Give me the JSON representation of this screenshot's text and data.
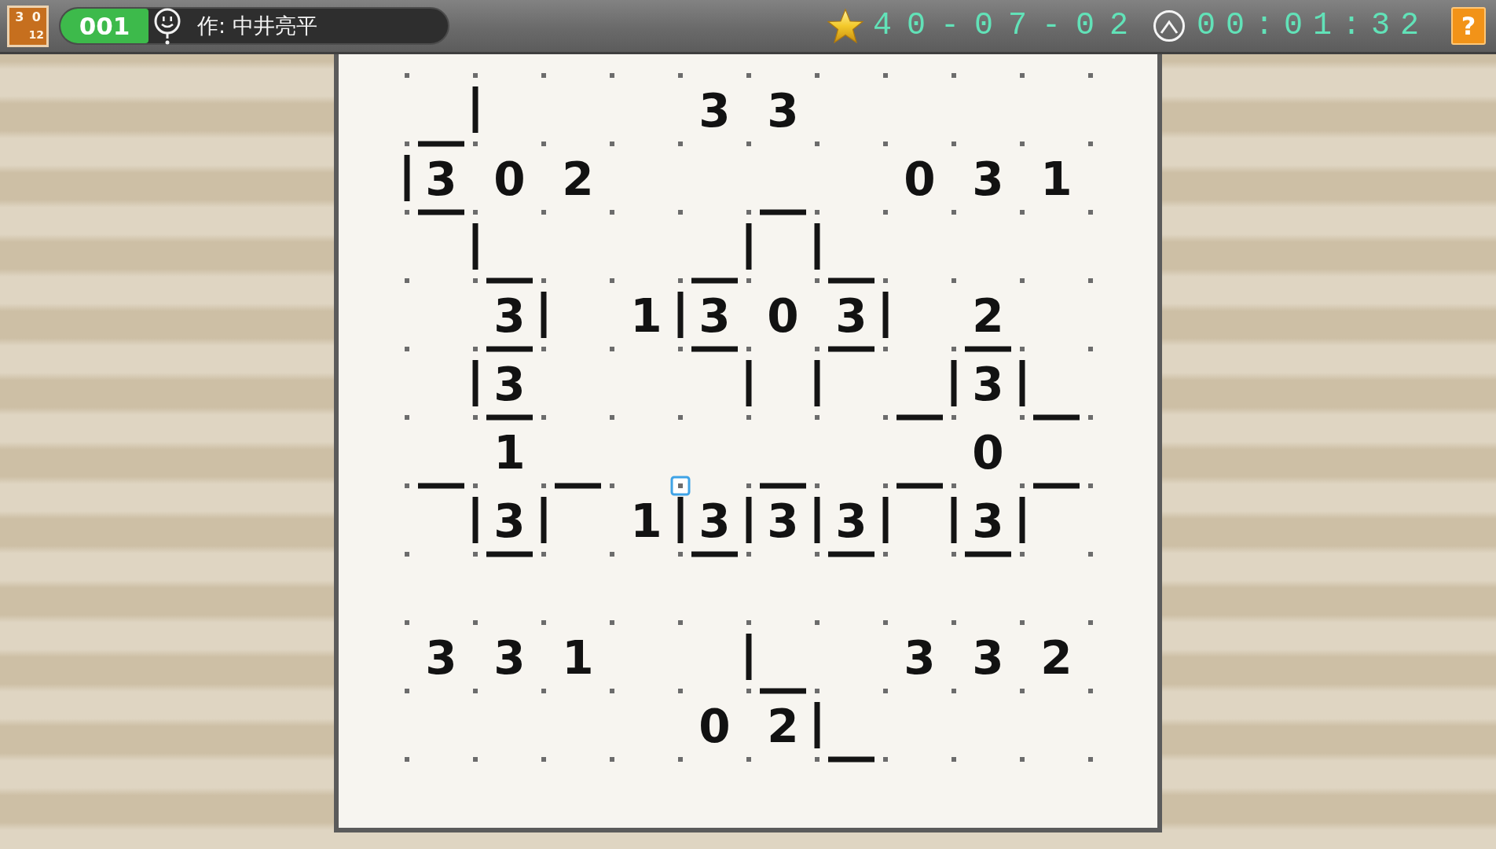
{
  "header": {
    "app_logo": {
      "top_digits": [
        "3",
        "0"
      ],
      "bottom_digits": "12"
    },
    "puzzle_number": "001",
    "author": "作: 中井亮平",
    "date_code": "40-07-02",
    "timer": "00:01:32",
    "help_button": "?"
  },
  "grid": {
    "rows": [
      [
        {
          "kind": "dot"
        },
        {
          "kind": "gap"
        },
        {
          "kind": "dot"
        },
        {
          "kind": "gap"
        },
        {
          "kind": "dot"
        },
        {
          "kind": "gap"
        },
        {
          "kind": "dot"
        },
        {
          "kind": "gap"
        },
        {
          "kind": "dot"
        },
        {
          "kind": "gap"
        },
        {
          "kind": "dot"
        },
        {
          "kind": "gap"
        },
        {
          "kind": "dot"
        },
        {
          "kind": "gap"
        },
        {
          "kind": "dot"
        },
        {
          "kind": "gap"
        },
        {
          "kind": "dot"
        },
        {
          "kind": "gap"
        },
        {
          "kind": "dot"
        },
        {
          "kind": "gap"
        },
        {
          "kind": "dot"
        }
      ],
      [
        {
          "kind": "gap"
        },
        {
          "kind": "blank"
        },
        {
          "kind": "line"
        },
        {
          "kind": "blank"
        },
        {
          "kind": "gap"
        },
        {
          "kind": "blank"
        },
        {
          "kind": "gap"
        },
        {
          "kind": "blank"
        },
        {
          "kind": "gap"
        },
        {
          "kind": "clue",
          "text": "3"
        },
        {
          "kind": "gap"
        },
        {
          "kind": "clue",
          "text": "3"
        },
        {
          "kind": "gap"
        },
        {
          "kind": "blank"
        },
        {
          "kind": "gap"
        },
        {
          "kind": "blank"
        },
        {
          "kind": "gap"
        },
        {
          "kind": "blank"
        },
        {
          "kind": "gap"
        },
        {
          "kind": "blank"
        },
        {
          "kind": "gap"
        }
      ],
      [
        {
          "kind": "dot"
        },
        {
          "kind": "line"
        },
        {
          "kind": "dot"
        },
        {
          "kind": "gap"
        },
        {
          "kind": "dot"
        },
        {
          "kind": "gap"
        },
        {
          "kind": "dot"
        },
        {
          "kind": "gap"
        },
        {
          "kind": "dot"
        },
        {
          "kind": "gap"
        },
        {
          "kind": "dot"
        },
        {
          "kind": "gap"
        },
        {
          "kind": "dot"
        },
        {
          "kind": "gap"
        },
        {
          "kind": "dot"
        },
        {
          "kind": "gap"
        },
        {
          "kind": "dot"
        },
        {
          "kind": "gap"
        },
        {
          "kind": "dot"
        },
        {
          "kind": "gap"
        },
        {
          "kind": "dot"
        }
      ],
      [
        {
          "kind": "line"
        },
        {
          "kind": "clue",
          "text": "3"
        },
        {
          "kind": "gap"
        },
        {
          "kind": "clue",
          "text": "0"
        },
        {
          "kind": "gap"
        },
        {
          "kind": "clue",
          "text": "2"
        },
        {
          "kind": "gap"
        },
        {
          "kind": "blank"
        },
        {
          "kind": "gap"
        },
        {
          "kind": "blank"
        },
        {
          "kind": "gap"
        },
        {
          "kind": "blank"
        },
        {
          "kind": "gap"
        },
        {
          "kind": "blank"
        },
        {
          "kind": "gap"
        },
        {
          "kind": "clue",
          "text": "0"
        },
        {
          "kind": "gap"
        },
        {
          "kind": "clue",
          "text": "3"
        },
        {
          "kind": "gap"
        },
        {
          "kind": "clue",
          "text": "1"
        },
        {
          "kind": "gap"
        }
      ],
      [
        {
          "kind": "dot"
        },
        {
          "kind": "line"
        },
        {
          "kind": "dot"
        },
        {
          "kind": "gap"
        },
        {
          "kind": "dot"
        },
        {
          "kind": "gap"
        },
        {
          "kind": "dot"
        },
        {
          "kind": "gap"
        },
        {
          "kind": "dot"
        },
        {
          "kind": "gap"
        },
        {
          "kind": "dot"
        },
        {
          "kind": "line"
        },
        {
          "kind": "dot"
        },
        {
          "kind": "gap"
        },
        {
          "kind": "dot"
        },
        {
          "kind": "gap"
        },
        {
          "kind": "dot"
        },
        {
          "kind": "gap"
        },
        {
          "kind": "dot"
        },
        {
          "kind": "gap"
        },
        {
          "kind": "dot"
        }
      ],
      [
        {
          "kind": "gap"
        },
        {
          "kind": "blank"
        },
        {
          "kind": "line"
        },
        {
          "kind": "blank"
        },
        {
          "kind": "gap"
        },
        {
          "kind": "blank"
        },
        {
          "kind": "gap"
        },
        {
          "kind": "blank"
        },
        {
          "kind": "gap"
        },
        {
          "kind": "blank"
        },
        {
          "kind": "line"
        },
        {
          "kind": "blank"
        },
        {
          "kind": "line"
        },
        {
          "kind": "blank"
        },
        {
          "kind": "gap"
        },
        {
          "kind": "blank"
        },
        {
          "kind": "gap"
        },
        {
          "kind": "blank"
        },
        {
          "kind": "gap"
        },
        {
          "kind": "blank"
        },
        {
          "kind": "gap"
        }
      ],
      [
        {
          "kind": "dot"
        },
        {
          "kind": "gap"
        },
        {
          "kind": "dot"
        },
        {
          "kind": "line"
        },
        {
          "kind": "dot"
        },
        {
          "kind": "gap"
        },
        {
          "kind": "dot"
        },
        {
          "kind": "gap"
        },
        {
          "kind": "dot"
        },
        {
          "kind": "line"
        },
        {
          "kind": "dot"
        },
        {
          "kind": "gap"
        },
        {
          "kind": "dot"
        },
        {
          "kind": "line"
        },
        {
          "kind": "dot"
        },
        {
          "kind": "gap"
        },
        {
          "kind": "dot"
        },
        {
          "kind": "gap"
        },
        {
          "kind": "dot"
        },
        {
          "kind": "gap"
        },
        {
          "kind": "dot"
        }
      ],
      [
        {
          "kind": "gap"
        },
        {
          "kind": "blank"
        },
        {
          "kind": "gap"
        },
        {
          "kind": "clue",
          "text": "3"
        },
        {
          "kind": "line"
        },
        {
          "kind": "blank"
        },
        {
          "kind": "gap"
        },
        {
          "kind": "clue",
          "text": "1"
        },
        {
          "kind": "line"
        },
        {
          "kind": "clue",
          "text": "3"
        },
        {
          "kind": "gap"
        },
        {
          "kind": "clue",
          "text": "0"
        },
        {
          "kind": "gap"
        },
        {
          "kind": "clue",
          "text": "3"
        },
        {
          "kind": "line"
        },
        {
          "kind": "blank"
        },
        {
          "kind": "gap"
        },
        {
          "kind": "clue",
          "text": "2"
        },
        {
          "kind": "gap"
        },
        {
          "kind": "blank"
        },
        {
          "kind": "gap"
        }
      ],
      [
        {
          "kind": "dot"
        },
        {
          "kind": "gap"
        },
        {
          "kind": "dot"
        },
        {
          "kind": "line"
        },
        {
          "kind": "dot"
        },
        {
          "kind": "gap"
        },
        {
          "kind": "dot"
        },
        {
          "kind": "gap"
        },
        {
          "kind": "dot"
        },
        {
          "kind": "line"
        },
        {
          "kind": "dot"
        },
        {
          "kind": "gap"
        },
        {
          "kind": "dot"
        },
        {
          "kind": "line"
        },
        {
          "kind": "dot"
        },
        {
          "kind": "gap"
        },
        {
          "kind": "dot"
        },
        {
          "kind": "line"
        },
        {
          "kind": "dot"
        },
        {
          "kind": "gap"
        },
        {
          "kind": "dot"
        }
      ],
      [
        {
          "kind": "gap"
        },
        {
          "kind": "blank"
        },
        {
          "kind": "line"
        },
        {
          "kind": "clue",
          "text": "3"
        },
        {
          "kind": "gap"
        },
        {
          "kind": "blank"
        },
        {
          "kind": "gap"
        },
        {
          "kind": "blank"
        },
        {
          "kind": "gap"
        },
        {
          "kind": "blank"
        },
        {
          "kind": "line"
        },
        {
          "kind": "blank"
        },
        {
          "kind": "line"
        },
        {
          "kind": "blank"
        },
        {
          "kind": "gap"
        },
        {
          "kind": "blank"
        },
        {
          "kind": "line"
        },
        {
          "kind": "clue",
          "text": "3"
        },
        {
          "kind": "line"
        },
        {
          "kind": "blank"
        },
        {
          "kind": "gap"
        }
      ],
      [
        {
          "kind": "dot"
        },
        {
          "kind": "gap"
        },
        {
          "kind": "dot"
        },
        {
          "kind": "line"
        },
        {
          "kind": "dot"
        },
        {
          "kind": "gap"
        },
        {
          "kind": "dot"
        },
        {
          "kind": "gap"
        },
        {
          "kind": "dot"
        },
        {
          "kind": "gap"
        },
        {
          "kind": "dot"
        },
        {
          "kind": "gap"
        },
        {
          "kind": "dot"
        },
        {
          "kind": "gap"
        },
        {
          "kind": "dot"
        },
        {
          "kind": "line"
        },
        {
          "kind": "dot"
        },
        {
          "kind": "gap"
        },
        {
          "kind": "dot"
        },
        {
          "kind": "line"
        },
        {
          "kind": "dot"
        }
      ],
      [
        {
          "kind": "gap"
        },
        {
          "kind": "blank"
        },
        {
          "kind": "gap"
        },
        {
          "kind": "clue",
          "text": "1"
        },
        {
          "kind": "gap"
        },
        {
          "kind": "blank"
        },
        {
          "kind": "gap"
        },
        {
          "kind": "blank"
        },
        {
          "kind": "gap"
        },
        {
          "kind": "blank"
        },
        {
          "kind": "gap"
        },
        {
          "kind": "blank"
        },
        {
          "kind": "gap"
        },
        {
          "kind": "blank"
        },
        {
          "kind": "gap"
        },
        {
          "kind": "blank"
        },
        {
          "kind": "gap"
        },
        {
          "kind": "clue",
          "text": "0"
        },
        {
          "kind": "gap"
        },
        {
          "kind": "blank"
        },
        {
          "kind": "gap"
        }
      ],
      [
        {
          "kind": "dot"
        },
        {
          "kind": "line"
        },
        {
          "kind": "dot"
        },
        {
          "kind": "gap"
        },
        {
          "kind": "dot"
        },
        {
          "kind": "line"
        },
        {
          "kind": "dot"
        },
        {
          "kind": "gap"
        },
        {
          "kind": "cursor"
        },
        {
          "kind": "gap"
        },
        {
          "kind": "dot"
        },
        {
          "kind": "line"
        },
        {
          "kind": "dot"
        },
        {
          "kind": "gap"
        },
        {
          "kind": "dot"
        },
        {
          "kind": "line"
        },
        {
          "kind": "dot"
        },
        {
          "kind": "gap"
        },
        {
          "kind": "dot"
        },
        {
          "kind": "line"
        },
        {
          "kind": "dot"
        }
      ],
      [
        {
          "kind": "gap"
        },
        {
          "kind": "blank"
        },
        {
          "kind": "line"
        },
        {
          "kind": "clue",
          "text": "3"
        },
        {
          "kind": "line"
        },
        {
          "kind": "blank"
        },
        {
          "kind": "gap"
        },
        {
          "kind": "clue",
          "text": "1"
        },
        {
          "kind": "line"
        },
        {
          "kind": "clue",
          "text": "3"
        },
        {
          "kind": "line"
        },
        {
          "kind": "clue",
          "text": "3"
        },
        {
          "kind": "line"
        },
        {
          "kind": "clue",
          "text": "3"
        },
        {
          "kind": "line"
        },
        {
          "kind": "blank"
        },
        {
          "kind": "line"
        },
        {
          "kind": "clue",
          "text": "3"
        },
        {
          "kind": "line"
        },
        {
          "kind": "blank"
        },
        {
          "kind": "gap"
        }
      ],
      [
        {
          "kind": "dot"
        },
        {
          "kind": "gap"
        },
        {
          "kind": "dot"
        },
        {
          "kind": "line"
        },
        {
          "kind": "dot"
        },
        {
          "kind": "gap"
        },
        {
          "kind": "dot"
        },
        {
          "kind": "gap"
        },
        {
          "kind": "dot"
        },
        {
          "kind": "line"
        },
        {
          "kind": "dot"
        },
        {
          "kind": "gap"
        },
        {
          "kind": "dot"
        },
        {
          "kind": "line"
        },
        {
          "kind": "dot"
        },
        {
          "kind": "gap"
        },
        {
          "kind": "dot"
        },
        {
          "kind": "line"
        },
        {
          "kind": "dot"
        },
        {
          "kind": "gap"
        },
        {
          "kind": "dot"
        }
      ],
      [
        {
          "kind": "gap"
        },
        {
          "kind": "blank"
        },
        {
          "kind": "gap"
        },
        {
          "kind": "blank"
        },
        {
          "kind": "gap"
        },
        {
          "kind": "blank"
        },
        {
          "kind": "gap"
        },
        {
          "kind": "blank"
        },
        {
          "kind": "gap"
        },
        {
          "kind": "blank"
        },
        {
          "kind": "gap"
        },
        {
          "kind": "blank"
        },
        {
          "kind": "gap"
        },
        {
          "kind": "blank"
        },
        {
          "kind": "gap"
        },
        {
          "kind": "blank"
        },
        {
          "kind": "gap"
        },
        {
          "kind": "blank"
        },
        {
          "kind": "gap"
        },
        {
          "kind": "blank"
        },
        {
          "kind": "gap"
        }
      ],
      [
        {
          "kind": "dot"
        },
        {
          "kind": "gap"
        },
        {
          "kind": "dot"
        },
        {
          "kind": "gap"
        },
        {
          "kind": "dot"
        },
        {
          "kind": "gap"
        },
        {
          "kind": "dot"
        },
        {
          "kind": "gap"
        },
        {
          "kind": "dot"
        },
        {
          "kind": "gap"
        },
        {
          "kind": "dot"
        },
        {
          "kind": "gap"
        },
        {
          "kind": "dot"
        },
        {
          "kind": "gap"
        },
        {
          "kind": "dot"
        },
        {
          "kind": "gap"
        },
        {
          "kind": "dot"
        },
        {
          "kind": "gap"
        },
        {
          "kind": "dot"
        },
        {
          "kind": "gap"
        },
        {
          "kind": "dot"
        }
      ],
      [
        {
          "kind": "gap"
        },
        {
          "kind": "clue",
          "text": "3"
        },
        {
          "kind": "gap"
        },
        {
          "kind": "clue",
          "text": "3"
        },
        {
          "kind": "gap"
        },
        {
          "kind": "clue",
          "text": "1"
        },
        {
          "kind": "gap"
        },
        {
          "kind": "blank"
        },
        {
          "kind": "gap"
        },
        {
          "kind": "blank"
        },
        {
          "kind": "line"
        },
        {
          "kind": "blank"
        },
        {
          "kind": "gap"
        },
        {
          "kind": "blank"
        },
        {
          "kind": "gap"
        },
        {
          "kind": "clue",
          "text": "3"
        },
        {
          "kind": "gap"
        },
        {
          "kind": "clue",
          "text": "3"
        },
        {
          "kind": "gap"
        },
        {
          "kind": "clue",
          "text": "2"
        },
        {
          "kind": "gap"
        }
      ],
      [
        {
          "kind": "dot"
        },
        {
          "kind": "gap"
        },
        {
          "kind": "dot"
        },
        {
          "kind": "gap"
        },
        {
          "kind": "dot"
        },
        {
          "kind": "gap"
        },
        {
          "kind": "dot"
        },
        {
          "kind": "gap"
        },
        {
          "kind": "dot"
        },
        {
          "kind": "gap"
        },
        {
          "kind": "dot"
        },
        {
          "kind": "line"
        },
        {
          "kind": "dot"
        },
        {
          "kind": "gap"
        },
        {
          "kind": "dot"
        },
        {
          "kind": "gap"
        },
        {
          "kind": "dot"
        },
        {
          "kind": "gap"
        },
        {
          "kind": "dot"
        },
        {
          "kind": "gap"
        },
        {
          "kind": "dot"
        }
      ],
      [
        {
          "kind": "gap"
        },
        {
          "kind": "blank"
        },
        {
          "kind": "gap"
        },
        {
          "kind": "blank"
        },
        {
          "kind": "gap"
        },
        {
          "kind": "blank"
        },
        {
          "kind": "gap"
        },
        {
          "kind": "blank"
        },
        {
          "kind": "gap"
        },
        {
          "kind": "clue",
          "text": "0"
        },
        {
          "kind": "gap"
        },
        {
          "kind": "clue",
          "text": "2"
        },
        {
          "kind": "line"
        },
        {
          "kind": "blank"
        },
        {
          "kind": "gap"
        },
        {
          "kind": "blank"
        },
        {
          "kind": "gap"
        },
        {
          "kind": "blank"
        },
        {
          "kind": "gap"
        },
        {
          "kind": "blank"
        },
        {
          "kind": "gap"
        }
      ],
      [
        {
          "kind": "dot"
        },
        {
          "kind": "gap"
        },
        {
          "kind": "dot"
        },
        {
          "kind": "gap"
        },
        {
          "kind": "dot"
        },
        {
          "kind": "gap"
        },
        {
          "kind": "dot"
        },
        {
          "kind": "gap"
        },
        {
          "kind": "dot"
        },
        {
          "kind": "gap"
        },
        {
          "kind": "dot"
        },
        {
          "kind": "gap"
        },
        {
          "kind": "dot"
        },
        {
          "kind": "line"
        },
        {
          "kind": "dot"
        },
        {
          "kind": "gap"
        },
        {
          "kind": "dot"
        },
        {
          "kind": "gap"
        },
        {
          "kind": "dot"
        },
        {
          "kind": "gap"
        },
        {
          "kind": "dot"
        }
      ]
    ]
  }
}
